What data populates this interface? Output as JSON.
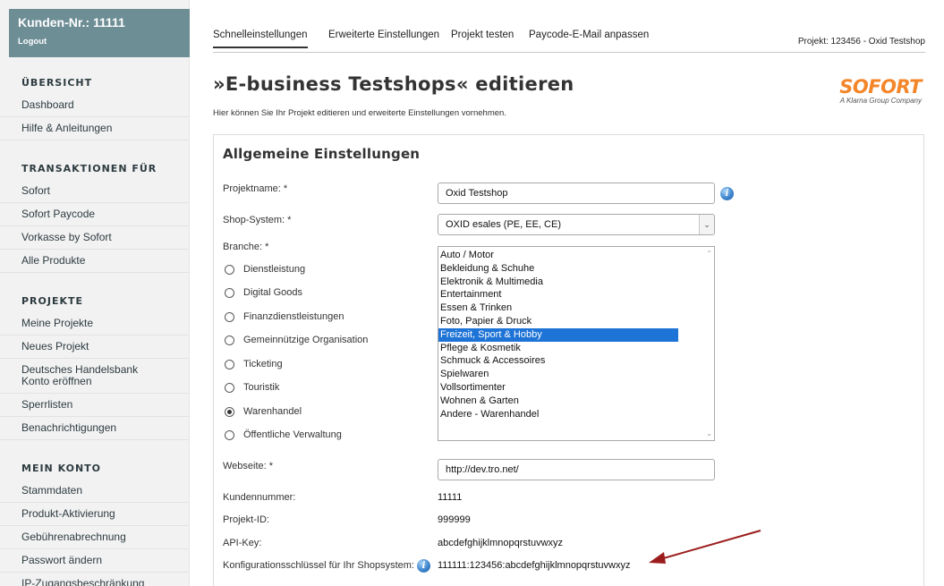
{
  "sidebar": {
    "customer_title": "Kunden-Nr.: 11111",
    "logout": "Logout",
    "sections": [
      {
        "heading": "ÜBERSICHT",
        "items": [
          "Dashboard",
          "Hilfe & Anleitungen"
        ]
      },
      {
        "heading": "TRANSAKTIONEN FÜR",
        "items": [
          "Sofort",
          "Sofort Paycode",
          "Vorkasse by Sofort",
          "Alle Produkte"
        ]
      },
      {
        "heading": "PROJEKTE",
        "items": [
          "Meine Projekte",
          "Neues Projekt",
          "Deutsches Handelsbank Konto eröffnen",
          "Sperrlisten",
          "Benachrichtigungen"
        ]
      },
      {
        "heading": "MEIN KONTO",
        "items": [
          "Stammdaten",
          "Produkt-Aktivierung",
          "Gebührenabrechnung",
          "Passwort ändern",
          "IP-Zugangsbeschränkung"
        ]
      }
    ]
  },
  "tabs": [
    "Schnelleinstellungen",
    "Erweiterte Einstellungen",
    "Projekt testen",
    "Paycode-E-Mail anpassen"
  ],
  "active_tab": 0,
  "project_info": "Projekt: 123456 - Oxid Testshop",
  "page": {
    "title": "»E-business Testshops« editieren",
    "subtitle": "Hier können Sie Ihr Projekt editieren und erweiterte Einstellungen vornehmen."
  },
  "logo": {
    "word": "SOFORT",
    "sub": "A Klarna Group Company",
    "color": "#f4862a"
  },
  "panel": {
    "title": "Allgemeine Einstellungen",
    "projektname_label": "Projektname: *",
    "projektname_value": "Oxid Testshop",
    "shop_system_label": "Shop-System: *",
    "shop_system_value": "OXID esales (PE, EE, CE)",
    "branche_label": "Branche: *",
    "branche_options": [
      "Dienstleistung",
      "Digital Goods",
      "Finanzdienstleistungen",
      "Gemeinnützige Organisation",
      "Ticketing",
      "Touristik",
      "Warenhandel",
      "Öffentliche Verwaltung"
    ],
    "branche_selected": "Warenhandel",
    "subcategories": [
      "Auto / Motor",
      "Bekleidung & Schuhe",
      "Elektronik & Multimedia",
      "Entertainment",
      "Essen & Trinken",
      "Foto, Papier & Druck",
      "Freizeit, Sport & Hobby",
      "Pflege & Kosmetik",
      "Schmuck & Accessoires",
      "Spielwaren",
      "Vollsortimenter",
      "Wohnen & Garten",
      "Andere - Warenhandel"
    ],
    "subcategory_selected": "Freizeit, Sport & Hobby",
    "webseite_label": "Webseite: *",
    "webseite_value": "http://dev.tro.net/",
    "kundennummer_label": "Kundennummer:",
    "kundennummer_value": "11111",
    "projekt_id_label": "Projekt-ID:",
    "projekt_id_value": "999999",
    "api_key_label": "API-Key:",
    "api_key_value": "abcdefghijklmnopqrstuvwxyz",
    "config_key_label": "Konfigurationsschlüssel für Ihr Shopsystem:",
    "config_key_value": "111111:123456:abcdefghijklmnopqrstuvwxyz"
  },
  "colors": {
    "sidebar_header": "#6e8e96",
    "selection": "#1e73d6",
    "arrow": "#9b1c1c"
  },
  "icons": {
    "info": "info-icon",
    "select_arrow": "chevron-down-icon",
    "annotation": "arrow-annotation"
  }
}
